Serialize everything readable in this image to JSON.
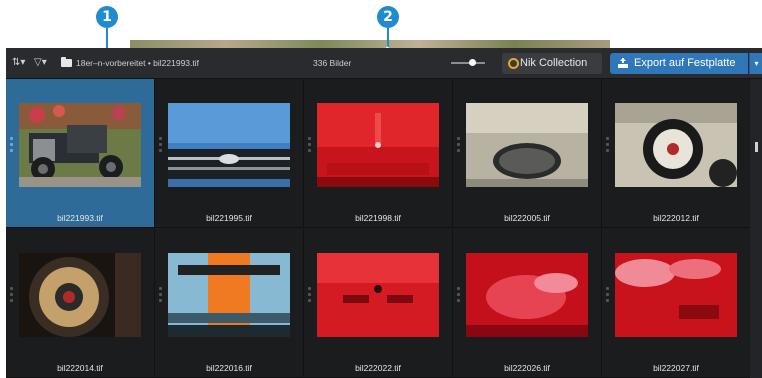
{
  "callouts": {
    "one": "1",
    "two": "2"
  },
  "toolbar": {
    "sort_icon": "sort-icon",
    "sort_glyph": "⇅▾",
    "filter_icon": "filter-icon",
    "filter_glyph": "▽▾",
    "breadcrumb": "18er–n-vorbereitet  •  bil221993.tif",
    "count": "336 Bilder",
    "nik_label": "Nik Collection",
    "export_label": "Export auf Festplatte",
    "export_arrow": "▾"
  },
  "colors": {
    "accent": "#2f77b8",
    "selection": "#2e6b98",
    "callout": "#1f8ccf",
    "nik_ring": "#f0a523"
  },
  "images": [
    {
      "name": "bil221993.tif",
      "selected": true
    },
    {
      "name": "bil221995.tif",
      "selected": false
    },
    {
      "name": "bil221998.tif",
      "selected": false
    },
    {
      "name": "bil222005.tif",
      "selected": false
    },
    {
      "name": "bil222012.tif",
      "selected": false
    },
    {
      "name": "bil222014.tif",
      "selected": false
    },
    {
      "name": "bil222016.tif",
      "selected": false
    },
    {
      "name": "bil222022.tif",
      "selected": false
    },
    {
      "name": "bil222026.tif",
      "selected": false
    },
    {
      "name": "bil222027.tif",
      "selected": false
    }
  ]
}
